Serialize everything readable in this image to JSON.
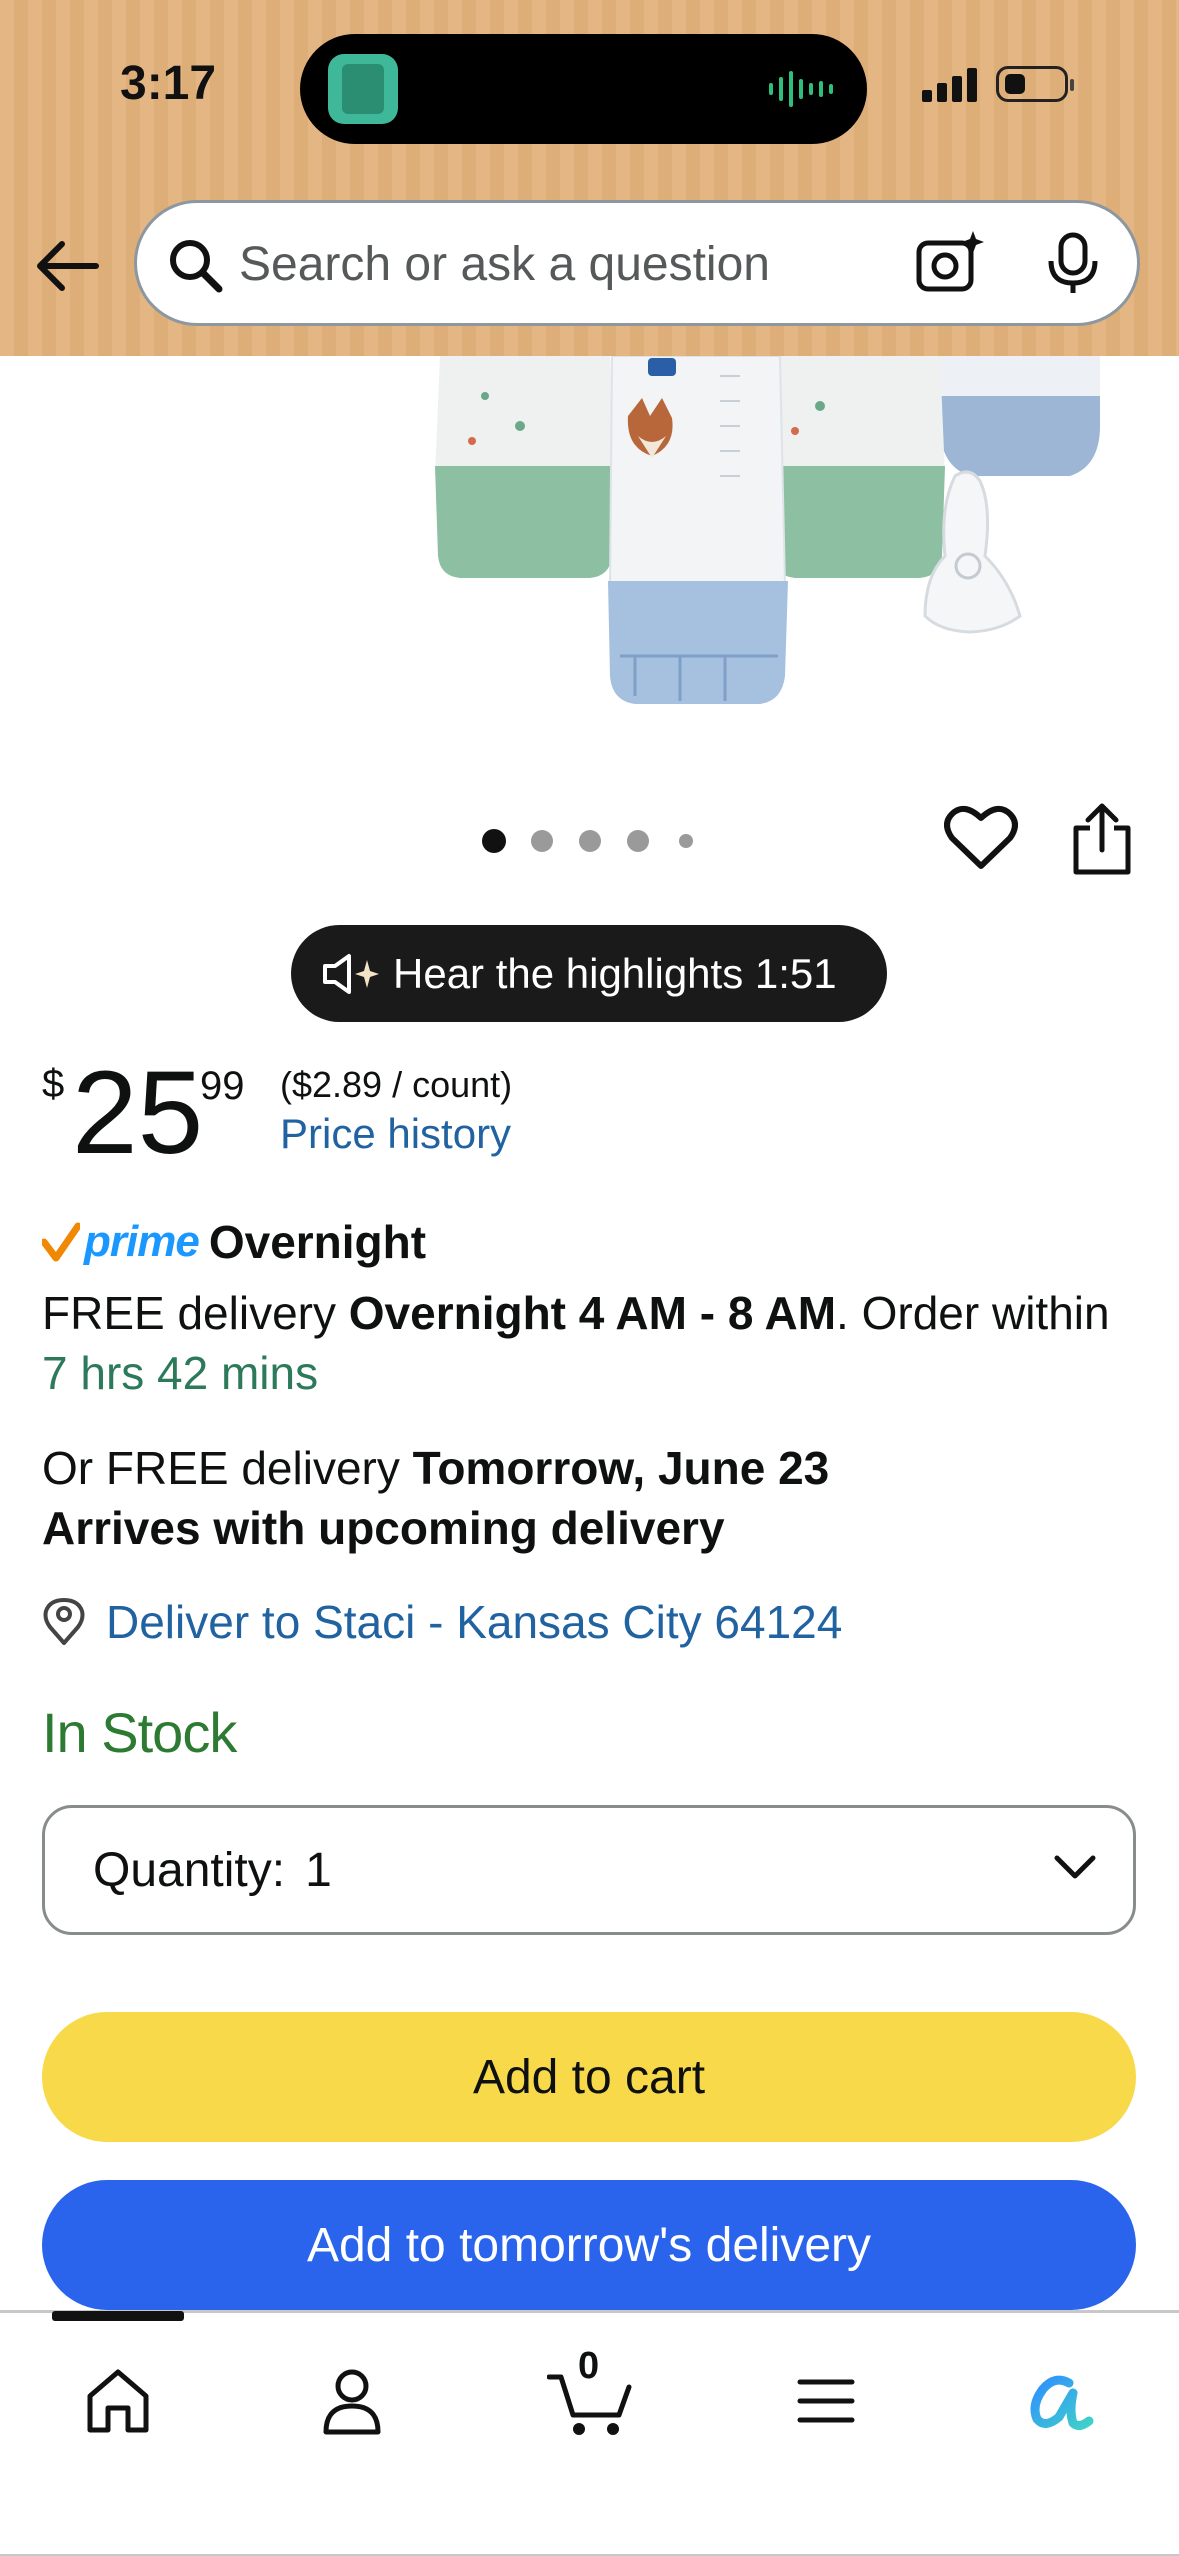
{
  "status_bar": {
    "time": "3:17"
  },
  "search": {
    "placeholder": "Search or ask a question"
  },
  "image_carousel": {
    "total_dots": 5,
    "active_index": 0
  },
  "hear_highlights": {
    "label": "Hear the highlights 1:51"
  },
  "price": {
    "symbol": "$",
    "whole": "25",
    "fraction": "99",
    "unit_price": "($2.89 / count)",
    "history_link": "Price history"
  },
  "delivery": {
    "prime_label": "prime",
    "prime_speed": "Overnight",
    "line1_prefix": "FREE delivery ",
    "line1_window": "Overnight 4 AM - 8 AM",
    "line1_suffix": ". Order within ",
    "line1_countdown": "7 hrs 42 mins",
    "line2_prefix": "Or FREE delivery ",
    "line2_date": "Tomorrow, June 23",
    "line2_note": "Arrives with upcoming delivery",
    "deliver_to": "Deliver to Staci - Kansas City 64124"
  },
  "stock": {
    "status": "In Stock"
  },
  "quantity": {
    "label": "Quantity:",
    "value": "1"
  },
  "buttons": {
    "add_to_cart": "Add to cart",
    "add_to_tomorrow": "Add to tomorrow's delivery"
  },
  "bottom_nav": {
    "items": [
      "home-icon",
      "account-icon",
      "cart-icon",
      "menu-icon",
      "rufus-icon"
    ],
    "cart_count": "0"
  },
  "colors": {
    "header_bg": "#e3b683",
    "link": "#2162a1",
    "in_stock": "#2d7a32",
    "countdown": "#2d7a5b",
    "cart_button": "#f7d94a",
    "tomorrow_button": "#2a64ed",
    "prime_blue": "#1a98ff",
    "prime_check": "#f08804"
  }
}
